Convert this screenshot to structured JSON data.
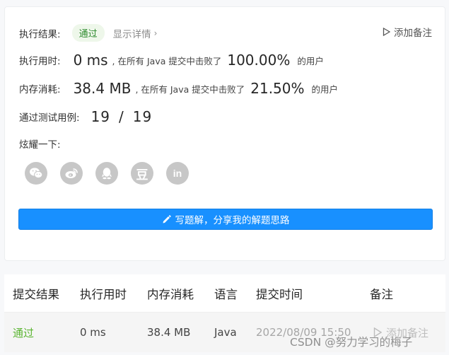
{
  "result": {
    "status_label": "执行结果:",
    "status_value": "通过",
    "details_link": "显示详情",
    "add_note": "添加备注",
    "runtime_label": "执行用时:",
    "runtime_value": "0 ms",
    "runtime_beat_text": ", 在所有 Java 提交中击败了",
    "runtime_percent": "100.00%",
    "runtime_suffix": "的用户",
    "memory_label": "内存消耗:",
    "memory_value": "38.4 MB",
    "memory_beat_text": ", 在所有 Java 提交中击败了",
    "memory_percent": "21.50%",
    "memory_suffix": "的用户",
    "tests_label": "通过测试用例:",
    "tests_passed": "19",
    "tests_sep": "/",
    "tests_total": "19",
    "share_label": "炫耀一下:",
    "share_icons": [
      "wechat-icon",
      "weibo-icon",
      "qq-icon",
      "douban-icon",
      "linkedin-icon"
    ],
    "douban_glyph": "豆",
    "linkedin_glyph": "in",
    "write_solution": "写题解，分享我的解题思路"
  },
  "history": {
    "headers": [
      "提交结果",
      "执行用时",
      "内存消耗",
      "语言",
      "提交时间",
      "备注"
    ],
    "rows": [
      {
        "result": "通过",
        "runtime": "0 ms",
        "memory": "38.4 MB",
        "language": "Java",
        "time": "2022/08/09 15:50",
        "note": "添加备注"
      }
    ]
  },
  "watermark": "CSDN @努力学习的梅子",
  "colors": {
    "accent": "#1890ff",
    "passed": "#5bb532",
    "badge_bg": "#eef7ea"
  }
}
